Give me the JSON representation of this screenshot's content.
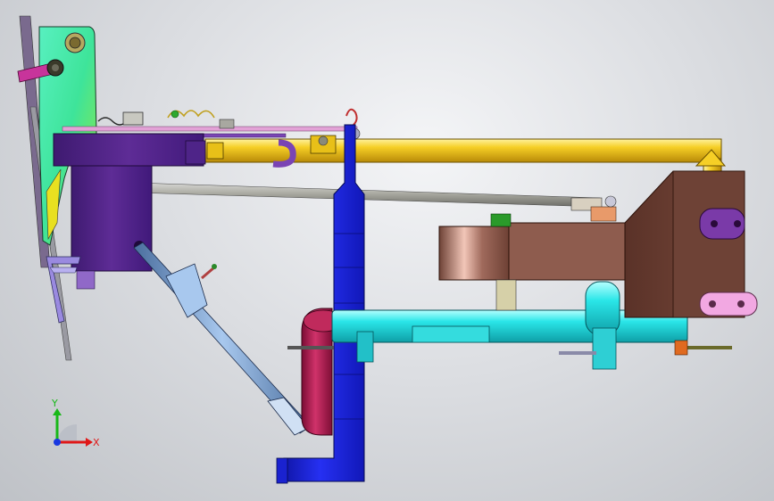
{
  "view": {
    "background_top": "#f2f3f5",
    "background_bottom": "#c0c3c8"
  },
  "parts": [
    {
      "name": "pivot-bracket",
      "color": "#4de8a8"
    },
    {
      "name": "pink-handle",
      "color": "#c8349b"
    },
    {
      "name": "purple-motor-housing",
      "color": "#5a2a8e"
    },
    {
      "name": "yellow-rail",
      "color": "#f2c21a"
    },
    {
      "name": "blue-vertical-arm",
      "color": "#1a22e0"
    },
    {
      "name": "cyan-cylinder",
      "color": "#22e2e4"
    },
    {
      "name": "brown-block",
      "color": "#8a5a4e"
    },
    {
      "name": "maroon-roller",
      "color": "#b0184e"
    },
    {
      "name": "steel-link",
      "color": "#7fa8d8"
    },
    {
      "name": "violet-clamp-plate",
      "color": "#9068c8"
    }
  ],
  "triad": {
    "x_label": "X",
    "y_label": "Y",
    "x_color": "#e01818",
    "y_color": "#18b818",
    "z_color": "#1838e0"
  }
}
